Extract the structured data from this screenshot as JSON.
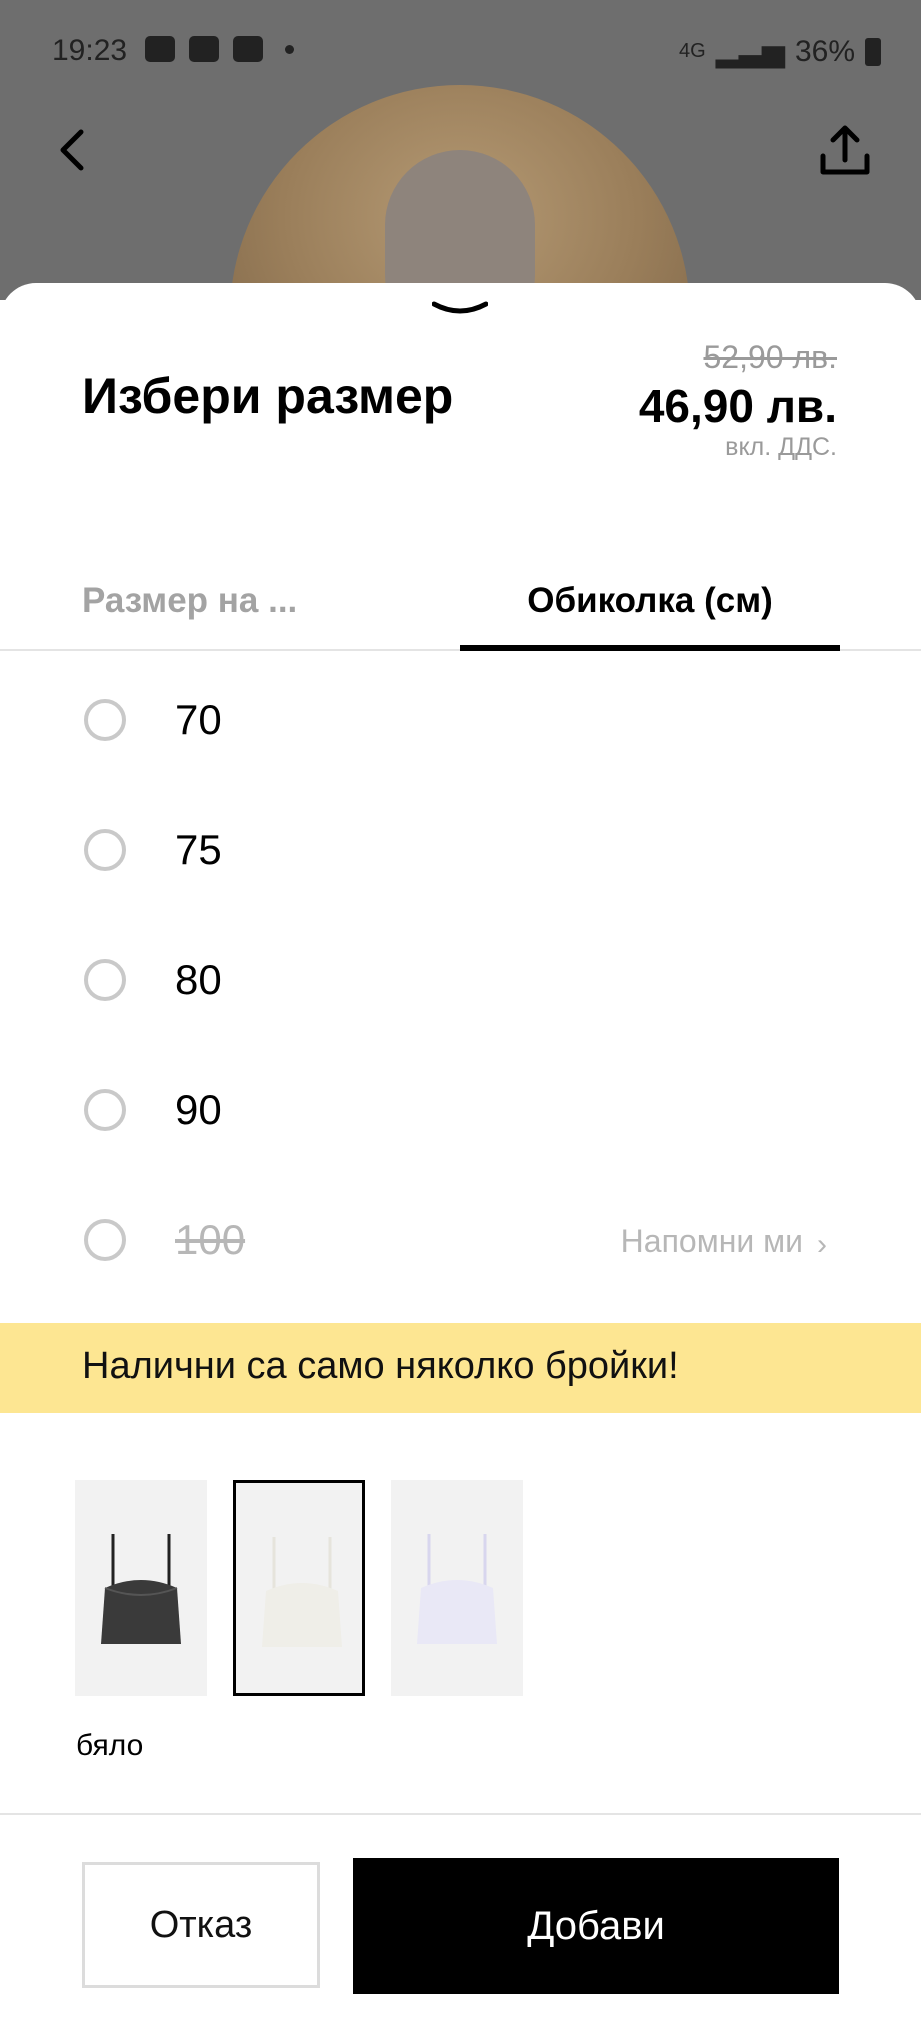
{
  "status_bar": {
    "time": "19:23",
    "network": "4G",
    "battery": "36%"
  },
  "header": {
    "back_icon": "chevron-left-icon",
    "share_icon": "share-icon"
  },
  "sheet": {
    "title": "Избери размер",
    "old_price": "52,90 лв.",
    "price": "46,90 лв.",
    "vat_note": "вкл. ДДС.",
    "tabs": [
      {
        "label": "Размер на ..."
      },
      {
        "label": "Обиколка (см)"
      }
    ],
    "sizes": [
      {
        "label": "70"
      },
      {
        "label": "75"
      },
      {
        "label": "80"
      },
      {
        "label": "90"
      },
      {
        "label": "100",
        "notify": "Напомни ми"
      }
    ],
    "banner": "Налични са само няколко бройки!",
    "selected_color": "бяло",
    "buttons": {
      "cancel": "Отказ",
      "add": "Добави"
    }
  },
  "colors": {
    "banner": "#fde692",
    "accent": "#000000"
  }
}
